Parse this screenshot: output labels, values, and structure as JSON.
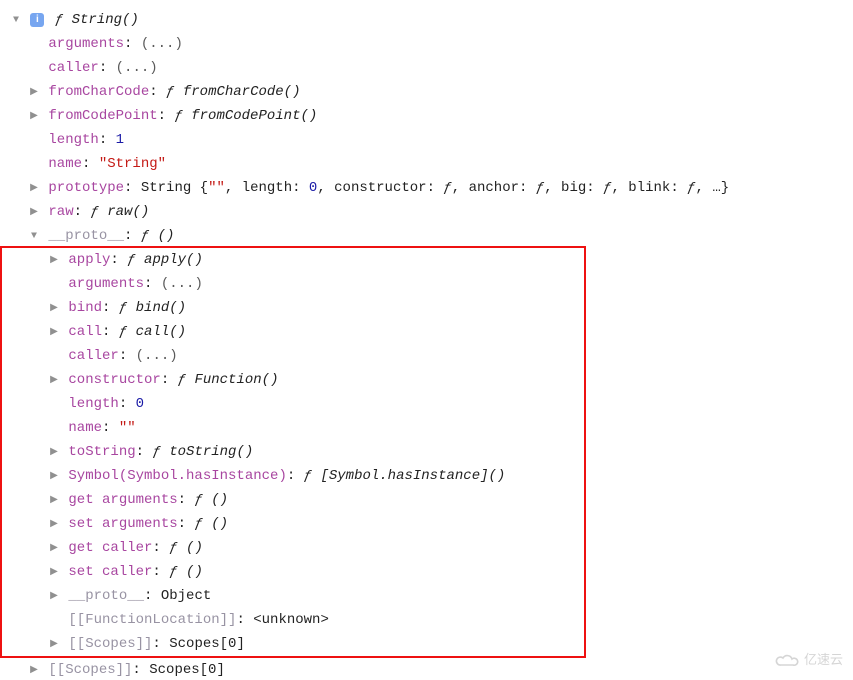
{
  "glyph": {
    "down": "▼",
    "right": "▶",
    "f": "ƒ"
  },
  "badge_char": "i",
  "root": {
    "head": {
      "f": "ƒ",
      "name": "String()"
    },
    "arguments": {
      "key": "arguments",
      "val": "(...)"
    },
    "caller": {
      "key": "caller",
      "val": "(...)"
    },
    "fromCharCode": {
      "key": "fromCharCode",
      "fn_name": "fromCharCode()"
    },
    "fromCodePoint": {
      "key": "fromCodePoint",
      "fn_name": "fromCodePoint()"
    },
    "length": {
      "key": "length",
      "num": "1"
    },
    "nameprop": {
      "key": "name",
      "str": "\"String\""
    },
    "prototype": {
      "key": "prototype",
      "summary_prefix": "String {",
      "summary_tail": ", …}",
      "parts": {
        "q": "\"\"",
        "len_k": "length",
        "len_v": "0",
        "ctor_k": "constructor",
        "anchor_k": "anchor",
        "big_k": "big",
        "blink_k": "blink"
      }
    },
    "raw": {
      "key": "raw",
      "fn_name": "raw()"
    }
  },
  "proto_label": "__proto__",
  "proto_fn_empty": "()",
  "proto": {
    "apply": {
      "key": "apply",
      "fn_name": "apply()"
    },
    "arguments": {
      "key": "arguments",
      "val": "(...)"
    },
    "bind": {
      "key": "bind",
      "fn_name": "bind()"
    },
    "call": {
      "key": "call",
      "fn_name": "call()"
    },
    "caller": {
      "key": "caller",
      "val": "(...)"
    },
    "constructor": {
      "key": "constructor",
      "fn_name": "Function()"
    },
    "length": {
      "key": "length",
      "num": "0"
    },
    "name": {
      "key": "name",
      "str": "\"\""
    },
    "toString": {
      "key": "toString",
      "fn_name": "toString()"
    },
    "symbol": {
      "key": "Symbol(Symbol.hasInstance)",
      "fn_name": "[Symbol.hasInstance]()"
    },
    "get_args": {
      "key": "get arguments",
      "fn_name": "()"
    },
    "set_args": {
      "key": "set arguments",
      "fn_name": "()"
    },
    "get_caller": {
      "key": "get caller",
      "fn_name": "()"
    },
    "set_caller": {
      "key": "set caller",
      "fn_name": "()"
    },
    "inner_proto": {
      "key": "__proto__",
      "val": "Object"
    },
    "fn_loc": {
      "key": "[[FunctionLocation]]",
      "val": "<unknown>"
    },
    "scopes": {
      "key": "[[Scopes]]",
      "val": "Scopes[0]"
    }
  },
  "outer_scopes": {
    "key": "[[Scopes]]",
    "val": "Scopes[0]"
  },
  "watermark": "亿速云"
}
